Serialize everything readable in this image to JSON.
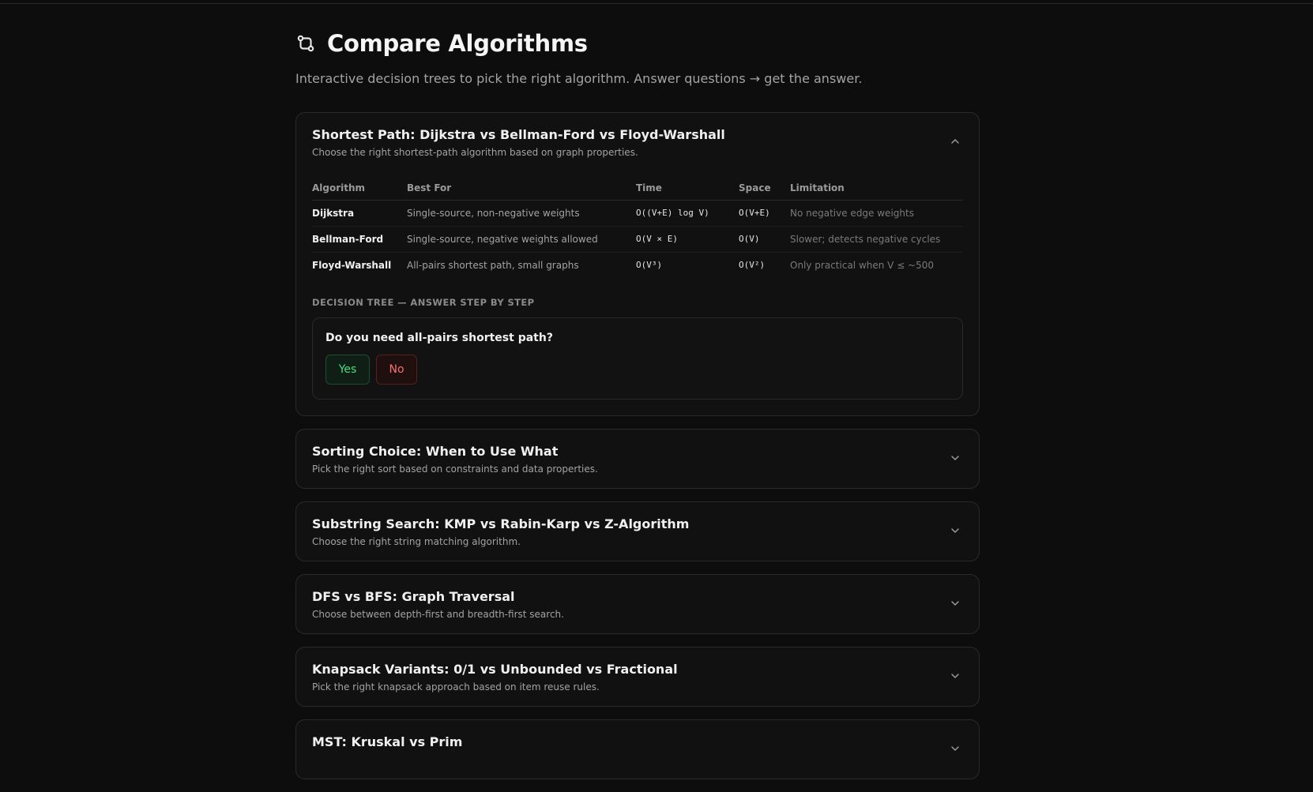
{
  "page": {
    "title": "Compare Algorithms",
    "subtitle": "Interactive decision trees to pick the right algorithm. Answer questions → get the answer.",
    "icon": "git-compare-icon"
  },
  "cards": [
    {
      "title": "Shortest Path: Dijkstra vs Bellman-Ford vs Floyd-Warshall",
      "description": "Choose the right shortest-path algorithm based on graph properties.",
      "expanded": true,
      "table": {
        "headers": [
          "Algorithm",
          "Best For",
          "Time",
          "Space",
          "Limitation"
        ],
        "rows": [
          [
            "Dijkstra",
            "Single-source, non-negative weights",
            "O((V+E) log V)",
            "O(V+E)",
            "No negative edge weights"
          ],
          [
            "Bellman-Ford",
            "Single-source, negative weights allowed",
            "O(V × E)",
            "O(V)",
            "Slower; detects negative cycles"
          ],
          [
            "Floyd-Warshall",
            "All-pairs shortest path, small graphs",
            "O(V³)",
            "O(V²)",
            "Only practical when V ≤ ~500"
          ]
        ]
      },
      "tree_label": "DECISION TREE — ANSWER STEP BY STEP",
      "question": "Do you need all-pairs shortest path?",
      "yes_label": "Yes",
      "no_label": "No"
    },
    {
      "title": "Sorting Choice: When to Use What",
      "description": "Pick the right sort based on constraints and data properties.",
      "expanded": false
    },
    {
      "title": "Substring Search: KMP vs Rabin-Karp vs Z-Algorithm",
      "description": "Choose the right string matching algorithm.",
      "expanded": false
    },
    {
      "title": "DFS vs BFS: Graph Traversal",
      "description": "Choose between depth-first and breadth-first search.",
      "expanded": false
    },
    {
      "title": "Knapsack Variants: 0/1 vs Unbounded vs Fractional",
      "description": "Pick the right knapsack approach based on item reuse rules.",
      "expanded": false
    },
    {
      "title": "MST: Kruskal vs Prim",
      "description": "",
      "expanded": false
    }
  ],
  "colors": {
    "background": "#0d0d0d",
    "card": "#111111",
    "border": "#2a2a2a",
    "yes": "#4ade80",
    "no": "#f87171"
  }
}
